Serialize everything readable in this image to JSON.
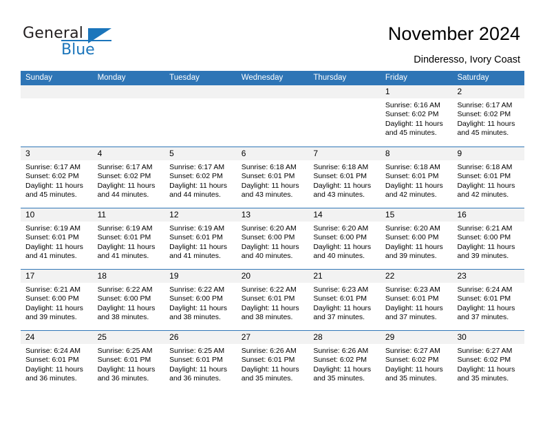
{
  "brand": {
    "name_part1": "General",
    "name_part2": "Blue",
    "accent_color": "#1b75bb"
  },
  "header": {
    "title": "November 2024",
    "subtitle": "Dinderesso, Ivory Coast"
  },
  "calendar": {
    "header_color": "#2e75b6",
    "daynum_band_color": "#f2f2f2",
    "weekdays": [
      "Sunday",
      "Monday",
      "Tuesday",
      "Wednesday",
      "Thursday",
      "Friday",
      "Saturday"
    ],
    "weeks": [
      [
        {
          "day": "",
          "sunrise": "",
          "sunset": "",
          "daylight1": "",
          "daylight2": "",
          "empty": true
        },
        {
          "day": "",
          "sunrise": "",
          "sunset": "",
          "daylight1": "",
          "daylight2": "",
          "empty": true
        },
        {
          "day": "",
          "sunrise": "",
          "sunset": "",
          "daylight1": "",
          "daylight2": "",
          "empty": true
        },
        {
          "day": "",
          "sunrise": "",
          "sunset": "",
          "daylight1": "",
          "daylight2": "",
          "empty": true
        },
        {
          "day": "",
          "sunrise": "",
          "sunset": "",
          "daylight1": "",
          "daylight2": "",
          "empty": true
        },
        {
          "day": "1",
          "sunrise": "Sunrise: 6:16 AM",
          "sunset": "Sunset: 6:02 PM",
          "daylight1": "Daylight: 11 hours",
          "daylight2": "and 45 minutes."
        },
        {
          "day": "2",
          "sunrise": "Sunrise: 6:17 AM",
          "sunset": "Sunset: 6:02 PM",
          "daylight1": "Daylight: 11 hours",
          "daylight2": "and 45 minutes."
        }
      ],
      [
        {
          "day": "3",
          "sunrise": "Sunrise: 6:17 AM",
          "sunset": "Sunset: 6:02 PM",
          "daylight1": "Daylight: 11 hours",
          "daylight2": "and 45 minutes."
        },
        {
          "day": "4",
          "sunrise": "Sunrise: 6:17 AM",
          "sunset": "Sunset: 6:02 PM",
          "daylight1": "Daylight: 11 hours",
          "daylight2": "and 44 minutes."
        },
        {
          "day": "5",
          "sunrise": "Sunrise: 6:17 AM",
          "sunset": "Sunset: 6:02 PM",
          "daylight1": "Daylight: 11 hours",
          "daylight2": "and 44 minutes."
        },
        {
          "day": "6",
          "sunrise": "Sunrise: 6:18 AM",
          "sunset": "Sunset: 6:01 PM",
          "daylight1": "Daylight: 11 hours",
          "daylight2": "and 43 minutes."
        },
        {
          "day": "7",
          "sunrise": "Sunrise: 6:18 AM",
          "sunset": "Sunset: 6:01 PM",
          "daylight1": "Daylight: 11 hours",
          "daylight2": "and 43 minutes."
        },
        {
          "day": "8",
          "sunrise": "Sunrise: 6:18 AM",
          "sunset": "Sunset: 6:01 PM",
          "daylight1": "Daylight: 11 hours",
          "daylight2": "and 42 minutes."
        },
        {
          "day": "9",
          "sunrise": "Sunrise: 6:18 AM",
          "sunset": "Sunset: 6:01 PM",
          "daylight1": "Daylight: 11 hours",
          "daylight2": "and 42 minutes."
        }
      ],
      [
        {
          "day": "10",
          "sunrise": "Sunrise: 6:19 AM",
          "sunset": "Sunset: 6:01 PM",
          "daylight1": "Daylight: 11 hours",
          "daylight2": "and 41 minutes."
        },
        {
          "day": "11",
          "sunrise": "Sunrise: 6:19 AM",
          "sunset": "Sunset: 6:01 PM",
          "daylight1": "Daylight: 11 hours",
          "daylight2": "and 41 minutes."
        },
        {
          "day": "12",
          "sunrise": "Sunrise: 6:19 AM",
          "sunset": "Sunset: 6:01 PM",
          "daylight1": "Daylight: 11 hours",
          "daylight2": "and 41 minutes."
        },
        {
          "day": "13",
          "sunrise": "Sunrise: 6:20 AM",
          "sunset": "Sunset: 6:00 PM",
          "daylight1": "Daylight: 11 hours",
          "daylight2": "and 40 minutes."
        },
        {
          "day": "14",
          "sunrise": "Sunrise: 6:20 AM",
          "sunset": "Sunset: 6:00 PM",
          "daylight1": "Daylight: 11 hours",
          "daylight2": "and 40 minutes."
        },
        {
          "day": "15",
          "sunrise": "Sunrise: 6:20 AM",
          "sunset": "Sunset: 6:00 PM",
          "daylight1": "Daylight: 11 hours",
          "daylight2": "and 39 minutes."
        },
        {
          "day": "16",
          "sunrise": "Sunrise: 6:21 AM",
          "sunset": "Sunset: 6:00 PM",
          "daylight1": "Daylight: 11 hours",
          "daylight2": "and 39 minutes."
        }
      ],
      [
        {
          "day": "17",
          "sunrise": "Sunrise: 6:21 AM",
          "sunset": "Sunset: 6:00 PM",
          "daylight1": "Daylight: 11 hours",
          "daylight2": "and 39 minutes."
        },
        {
          "day": "18",
          "sunrise": "Sunrise: 6:22 AM",
          "sunset": "Sunset: 6:00 PM",
          "daylight1": "Daylight: 11 hours",
          "daylight2": "and 38 minutes."
        },
        {
          "day": "19",
          "sunrise": "Sunrise: 6:22 AM",
          "sunset": "Sunset: 6:00 PM",
          "daylight1": "Daylight: 11 hours",
          "daylight2": "and 38 minutes."
        },
        {
          "day": "20",
          "sunrise": "Sunrise: 6:22 AM",
          "sunset": "Sunset: 6:01 PM",
          "daylight1": "Daylight: 11 hours",
          "daylight2": "and 38 minutes."
        },
        {
          "day": "21",
          "sunrise": "Sunrise: 6:23 AM",
          "sunset": "Sunset: 6:01 PM",
          "daylight1": "Daylight: 11 hours",
          "daylight2": "and 37 minutes."
        },
        {
          "day": "22",
          "sunrise": "Sunrise: 6:23 AM",
          "sunset": "Sunset: 6:01 PM",
          "daylight1": "Daylight: 11 hours",
          "daylight2": "and 37 minutes."
        },
        {
          "day": "23",
          "sunrise": "Sunrise: 6:24 AM",
          "sunset": "Sunset: 6:01 PM",
          "daylight1": "Daylight: 11 hours",
          "daylight2": "and 37 minutes."
        }
      ],
      [
        {
          "day": "24",
          "sunrise": "Sunrise: 6:24 AM",
          "sunset": "Sunset: 6:01 PM",
          "daylight1": "Daylight: 11 hours",
          "daylight2": "and 36 minutes."
        },
        {
          "day": "25",
          "sunrise": "Sunrise: 6:25 AM",
          "sunset": "Sunset: 6:01 PM",
          "daylight1": "Daylight: 11 hours",
          "daylight2": "and 36 minutes."
        },
        {
          "day": "26",
          "sunrise": "Sunrise: 6:25 AM",
          "sunset": "Sunset: 6:01 PM",
          "daylight1": "Daylight: 11 hours",
          "daylight2": "and 36 minutes."
        },
        {
          "day": "27",
          "sunrise": "Sunrise: 6:26 AM",
          "sunset": "Sunset: 6:01 PM",
          "daylight1": "Daylight: 11 hours",
          "daylight2": "and 35 minutes."
        },
        {
          "day": "28",
          "sunrise": "Sunrise: 6:26 AM",
          "sunset": "Sunset: 6:02 PM",
          "daylight1": "Daylight: 11 hours",
          "daylight2": "and 35 minutes."
        },
        {
          "day": "29",
          "sunrise": "Sunrise: 6:27 AM",
          "sunset": "Sunset: 6:02 PM",
          "daylight1": "Daylight: 11 hours",
          "daylight2": "and 35 minutes."
        },
        {
          "day": "30",
          "sunrise": "Sunrise: 6:27 AM",
          "sunset": "Sunset: 6:02 PM",
          "daylight1": "Daylight: 11 hours",
          "daylight2": "and 35 minutes."
        }
      ]
    ]
  }
}
